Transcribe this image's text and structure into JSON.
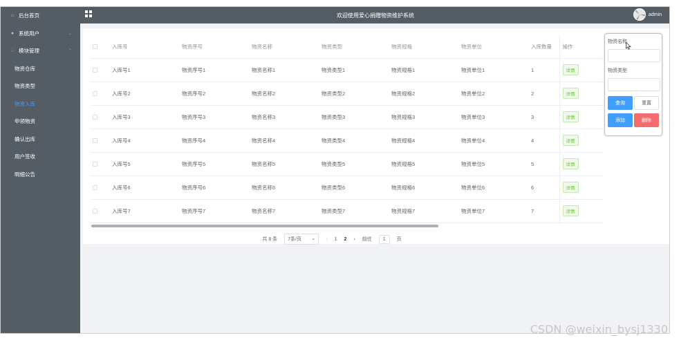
{
  "header": {
    "title": "欢迎使用爱心捐赠物资维护系统",
    "user": "admin"
  },
  "sidebar": {
    "home": "后台首页",
    "system_users": "系统用户",
    "module_manage": "模块管理",
    "sub_items": [
      {
        "label": "物资仓库",
        "active": false
      },
      {
        "label": "物资类型",
        "active": false
      },
      {
        "label": "物资入库",
        "active": true
      },
      {
        "label": "申领物资",
        "active": false
      },
      {
        "label": "确认出库",
        "active": false
      },
      {
        "label": "用户签收",
        "active": false
      },
      {
        "label": "明细公告",
        "active": false
      }
    ]
  },
  "table": {
    "columns": [
      "入库号",
      "物资序号",
      "物资名称",
      "物资类型",
      "物资规格",
      "物资单位",
      "入库数量",
      "操作"
    ],
    "detail_label": "详情",
    "rows": [
      [
        "入库号1",
        "物资序号1",
        "物资名称1",
        "物资类型1",
        "物资规格1",
        "物资单位1",
        "1"
      ],
      [
        "入库号2",
        "物资序号2",
        "物资名称2",
        "物资类型2",
        "物资规格2",
        "物资单位2",
        "2"
      ],
      [
        "入库号3",
        "物资序号3",
        "物资名称3",
        "物资类型3",
        "物资规格3",
        "物资单位3",
        "3"
      ],
      [
        "入库号4",
        "物资序号4",
        "物资名称4",
        "物资类型4",
        "物资规格4",
        "物资单位4",
        "4"
      ],
      [
        "入库号5",
        "物资序号5",
        "物资名称5",
        "物资类型5",
        "物资规格5",
        "物资单位5",
        "5"
      ],
      [
        "入库号6",
        "物资序号6",
        "物资名称6",
        "物资类型6",
        "物资规格6",
        "物资单位6",
        "6"
      ],
      [
        "入库号7",
        "物资序号7",
        "物资名称7",
        "物资类型7",
        "物资规格7",
        "物资单位7",
        "7"
      ]
    ]
  },
  "pagination": {
    "total": "共 8 条",
    "page_size": "7条/页",
    "prev": "‹",
    "pages": [
      "1",
      "2"
    ],
    "current": "1",
    "next": "›",
    "goto": "前往",
    "goto_value": "1",
    "page_suffix": "页"
  },
  "search": {
    "name_label": "物资名称",
    "type_label": "物资类型",
    "query_btn": "查询",
    "reset_btn": "重置",
    "add_btn": "添加",
    "delete_btn": "删除"
  },
  "watermark": "CSDN @weixin_bysj1330",
  "colors": {
    "sidebar_bg": "#545c64",
    "active": "#409eff",
    "success": "#67c23a",
    "danger": "#f56c6c"
  }
}
